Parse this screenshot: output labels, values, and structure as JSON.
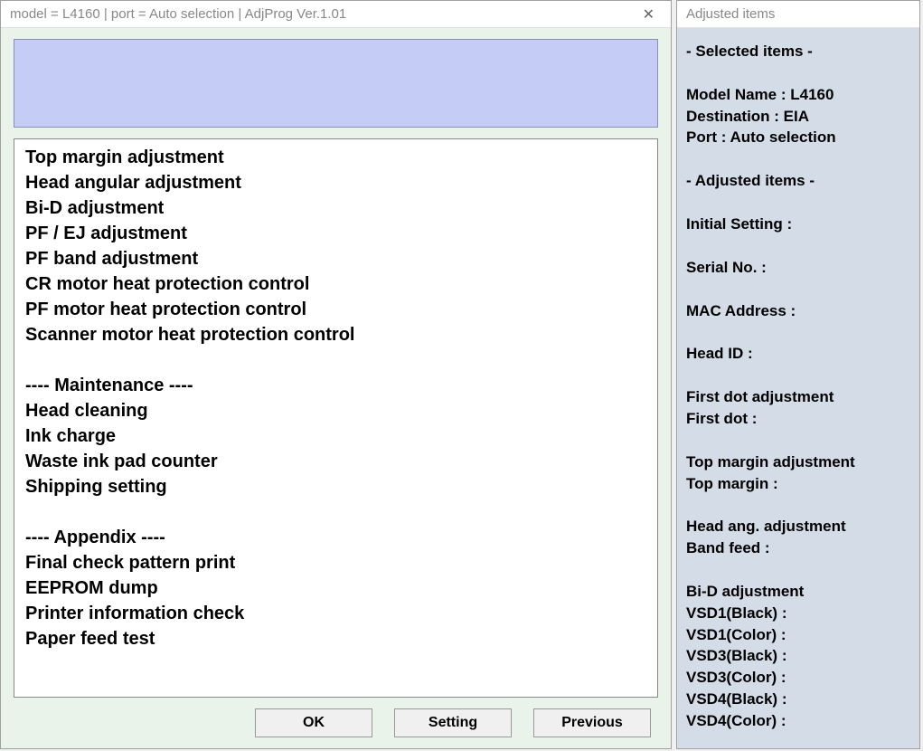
{
  "main": {
    "title": "model = L4160 | port = Auto selection | AdjProg Ver.1.01",
    "close_label": "✕",
    "listbox_items": [
      "Top margin adjustment",
      "Head angular adjustment",
      "Bi-D adjustment",
      "PF / EJ adjustment",
      "PF band adjustment",
      "CR motor heat protection control",
      "PF motor heat protection control",
      "Scanner motor heat protection control",
      "",
      "---- Maintenance ----",
      "Head cleaning",
      "Ink charge",
      "Waste ink pad counter",
      "Shipping setting",
      "",
      "---- Appendix ----",
      "Final check pattern print",
      "EEPROM dump",
      "Printer information check",
      "Paper feed test"
    ],
    "buttons": {
      "ok": "OK",
      "setting": "Setting",
      "previous": "Previous"
    }
  },
  "side": {
    "title": "Adjusted items",
    "lines": [
      "- Selected items -",
      "",
      "Model Name : L4160",
      "Destination : EIA",
      "Port : Auto selection",
      "",
      "- Adjusted items -",
      "",
      "Initial Setting :",
      "",
      "Serial No. :",
      "",
      "MAC Address :",
      "",
      "Head ID :",
      "",
      "First dot adjustment",
      " First dot :",
      "",
      "Top margin adjustment",
      " Top margin :",
      "",
      "Head ang. adjustment",
      " Band feed :",
      "",
      "Bi-D adjustment",
      " VSD1(Black) :",
      " VSD1(Color) :",
      " VSD3(Black) :",
      " VSD3(Color) :",
      " VSD4(Black) :",
      " VSD4(Color) :"
    ]
  }
}
